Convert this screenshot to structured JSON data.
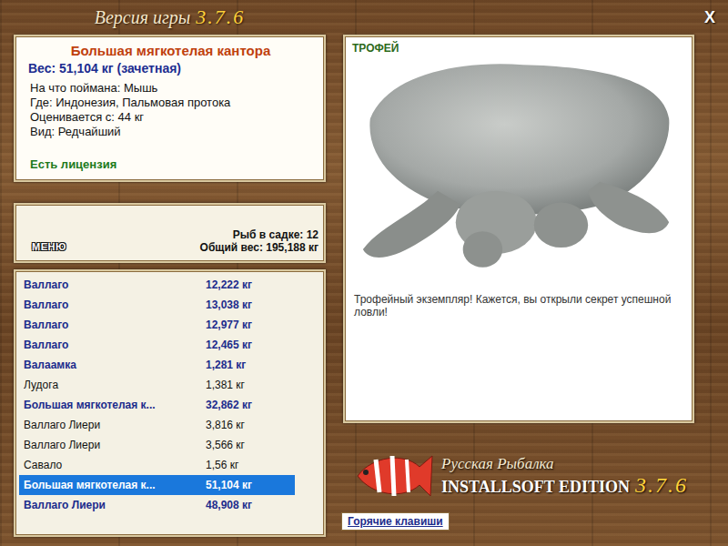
{
  "window": {
    "title": "Версия игры",
    "version": "3.7.6",
    "close": "X"
  },
  "fish": {
    "name": "Большая мягкотелая кантора",
    "weight": "Вес: 51,104 кг (зачетная)",
    "details": [
      "На что поймана: Мышь",
      "Где: Индонезия, Пальмовая протока",
      "Оценивается с: 44 кг",
      "Вид: Редчайший"
    ],
    "license": "Есть лицензия"
  },
  "keepnet": {
    "menu": "МЕНЮ",
    "count": "Рыб в садке: 12",
    "total": "Общий вес: 195,188 кг"
  },
  "catch_list": [
    {
      "name": "Валлаго",
      "weight": "12,222 кг",
      "trophy": true,
      "selected": false
    },
    {
      "name": "Валлаго",
      "weight": "13,038 кг",
      "trophy": true,
      "selected": false
    },
    {
      "name": "Валлаго",
      "weight": "12,977 кг",
      "trophy": true,
      "selected": false
    },
    {
      "name": "Валлаго",
      "weight": "12,465 кг",
      "trophy": true,
      "selected": false
    },
    {
      "name": "Валаамка",
      "weight": "1,281 кг",
      "trophy": true,
      "selected": false
    },
    {
      "name": "Лудога",
      "weight": "1,381 кг",
      "trophy": false,
      "selected": false
    },
    {
      "name": "Большая мягкотелая к...",
      "weight": "32,862 кг",
      "trophy": true,
      "selected": false
    },
    {
      "name": "Валлаго Лиери",
      "weight": "3,816 кг",
      "trophy": false,
      "selected": false
    },
    {
      "name": "Валлаго Лиери",
      "weight": "3,566 кг",
      "trophy": false,
      "selected": false
    },
    {
      "name": "Савало",
      "weight": "1,56 кг",
      "trophy": false,
      "selected": false
    },
    {
      "name": "Большая мягкотелая к...",
      "weight": "51,104 кг",
      "trophy": true,
      "selected": true
    },
    {
      "name": "Валлаго Лиери",
      "weight": "48,908 кг",
      "trophy": true,
      "selected": false
    }
  ],
  "trophy": {
    "label": "ТРОФЕЙ",
    "message": "Трофейный экземпляр! Кажется, вы открыли секрет успешной ловли!"
  },
  "logo": {
    "title": "Русская Рыбалка",
    "edition": "INSTALLSOFT EDITION",
    "version": "3.7.6"
  },
  "buttons": [
    "Горячие клавиши"
  ]
}
